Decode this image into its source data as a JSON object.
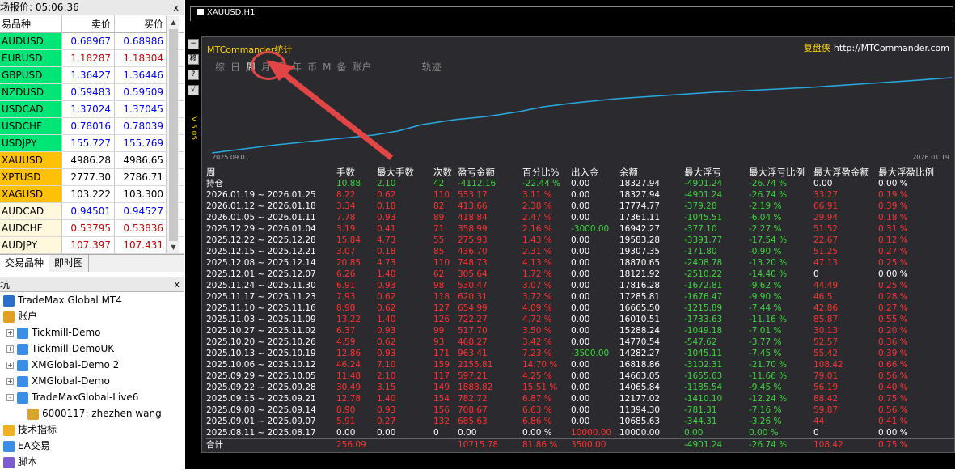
{
  "market_watch": {
    "title": "场报价: 05:06:36",
    "close": "x",
    "headers": [
      "易品种",
      "卖价",
      "买价"
    ],
    "rows": [
      {
        "sym": "AUDUSD",
        "bid": "0.68967",
        "ask": "0.68986",
        "bg": "#00e676",
        "bc": "#0000ff",
        "ac": "#0000ff"
      },
      {
        "sym": "EURUSD",
        "bid": "1.18287",
        "ask": "1.18304",
        "bg": "#00e676",
        "bc": "#cc0000",
        "ac": "#cc0000"
      },
      {
        "sym": "GBPUSD",
        "bid": "1.36427",
        "ask": "1.36446",
        "bg": "#00e676",
        "bc": "#0000ff",
        "ac": "#0000ff"
      },
      {
        "sym": "NZDUSD",
        "bid": "0.59483",
        "ask": "0.59509",
        "bg": "#00e676",
        "bc": "#0000ff",
        "ac": "#0000ff"
      },
      {
        "sym": "USDCAD",
        "bid": "1.37024",
        "ask": "1.37045",
        "bg": "#00e676",
        "bc": "#0000ff",
        "ac": "#0000ff"
      },
      {
        "sym": "USDCHF",
        "bid": "0.78016",
        "ask": "0.78039",
        "bg": "#00e676",
        "bc": "#0000ff",
        "ac": "#0000ff"
      },
      {
        "sym": "USDJPY",
        "bid": "155.727",
        "ask": "155.769",
        "bg": "#00e676",
        "bc": "#0000ff",
        "ac": "#0000ff"
      },
      {
        "sym": "XAUUSD",
        "bid": "4986.28",
        "ask": "4986.65",
        "bg": "#ffc107",
        "bc": "#000000",
        "ac": "#000000"
      },
      {
        "sym": "XPTUSD",
        "bid": "2777.30",
        "ask": "2786.71",
        "bg": "#ffc107",
        "bc": "#000000",
        "ac": "#000000"
      },
      {
        "sym": "XAGUSD",
        "bid": "103.222",
        "ask": "103.300",
        "bg": "#ffc107",
        "bc": "#000000",
        "ac": "#000000"
      },
      {
        "sym": "AUDCAD",
        "bid": "0.94501",
        "ask": "0.94527",
        "bg": "#fff8dc",
        "bc": "#0000ff",
        "ac": "#0000ff"
      },
      {
        "sym": "AUDCHF",
        "bid": "0.53795",
        "ask": "0.53836",
        "bg": "#fff8dc",
        "bc": "#cc0000",
        "ac": "#cc0000"
      },
      {
        "sym": "AUDJPY",
        "bid": "107.397",
        "ask": "107.431",
        "bg": "#fff8dc",
        "bc": "#cc0000",
        "ac": "#cc0000"
      }
    ],
    "tabs": [
      "交易品种",
      "即时图"
    ]
  },
  "navigator": {
    "title": "坑",
    "close": "x",
    "items": [
      {
        "label": "TradeMax Global MT4",
        "indent": 4,
        "pm": "",
        "icon": "terminal-icon"
      },
      {
        "label": "账户",
        "indent": 4,
        "pm": "",
        "icon": "accounts-icon"
      },
      {
        "label": "Tickmill-Demo",
        "indent": 8,
        "pm": "+",
        "icon": "server-icon"
      },
      {
        "label": "Tickmill-DemoUK",
        "indent": 8,
        "pm": "+",
        "icon": "server-icon"
      },
      {
        "label": "XMGlobal-Demo 2",
        "indent": 8,
        "pm": "+",
        "icon": "server-icon"
      },
      {
        "label": "XMGlobal-Demo",
        "indent": 8,
        "pm": "+",
        "icon": "server-icon"
      },
      {
        "label": "TradeMaxGlobal-Live6",
        "indent": 8,
        "pm": "-",
        "icon": "server-icon"
      },
      {
        "label": "6000117: zhezhen wang",
        "indent": 34,
        "pm": "",
        "icon": "user-icon"
      },
      {
        "label": "技术指标",
        "indent": 4,
        "pm": "",
        "icon": "indicator-icon"
      },
      {
        "label": "EA交易",
        "indent": 4,
        "pm": "",
        "icon": "ea-icon"
      },
      {
        "label": "脚本",
        "indent": 4,
        "pm": "",
        "icon": "script-icon"
      }
    ]
  },
  "chart": {
    "title": "XAUUSD,H1",
    "panel_title": "MTCommander统计",
    "brand_cn": "复盘侠",
    "brand_url": "http://MTCommander.com",
    "tabs": [
      "综",
      "日",
      "周",
      "月",
      "季",
      "年",
      "币",
      "M",
      "备",
      "账户",
      "轨迹"
    ],
    "active_tab": "周",
    "side_buttons": [
      "−",
      "移",
      "?",
      "√"
    ],
    "v_label": "V 5.05",
    "curve_start": "2025.09.01",
    "curve_end": "2026.01.19",
    "headers": [
      "周",
      "手数",
      "最大手数",
      "次数",
      "盈亏金额",
      "百分比%",
      "出入金",
      "余额",
      "最大浮亏",
      "最大浮亏比例",
      "最大浮盈金额",
      "最大浮盈比例"
    ],
    "hold_row": [
      "持仓",
      "10.88",
      "2.10",
      "42",
      "-4112.16",
      "-22.44 %",
      "0.00",
      "18327.94",
      "-4901.24",
      "-26.74 %",
      "0.00",
      "0.00 %"
    ],
    "rows": [
      [
        "2026.01.19 ~ 2026.01.25",
        "8.22",
        "0.62",
        "110",
        "553.17",
        "3.11 %",
        "0.00",
        "18327.94",
        "-4901.24",
        "-26.74 %",
        "33.27",
        "0.19 %"
      ],
      [
        "2026.01.12 ~ 2026.01.18",
        "3.34",
        "0.18",
        "82",
        "413.66",
        "2.38 %",
        "0.00",
        "17774.77",
        "-379.28",
        "-2.19 %",
        "66.91",
        "0.39 %"
      ],
      [
        "2026.01.05 ~ 2026.01.11",
        "7.78",
        "0.93",
        "89",
        "418.84",
        "2.47 %",
        "0.00",
        "17361.11",
        "-1045.51",
        "-6.04 %",
        "29.94",
        "0.18 %"
      ],
      [
        "2025.12.29 ~ 2026.01.04",
        "3.19",
        "0.41",
        "71",
        "358.99",
        "2.16 %",
        "-3000.00",
        "16942.27",
        "-377.10",
        "-2.27 %",
        "51.52",
        "0.31 %"
      ],
      [
        "2025.12.22 ~ 2025.12.28",
        "15.84",
        "4.73",
        "55",
        "275.93",
        "1.43 %",
        "0.00",
        "19583.28",
        "-3391.77",
        "-17.54 %",
        "22.67",
        "0.12 %"
      ],
      [
        "2025.12.15 ~ 2025.12.21",
        "3.07",
        "0.18",
        "85",
        "436.70",
        "2.31 %",
        "0.00",
        "19307.35",
        "-171.80",
        "-0.90 %",
        "51.25",
        "0.27 %"
      ],
      [
        "2025.12.08 ~ 2025.12.14",
        "20.85",
        "4.73",
        "110",
        "748.73",
        "4.13 %",
        "0.00",
        "18870.65",
        "-2408.78",
        "-13.20 %",
        "47.13",
        "0.25 %"
      ],
      [
        "2025.12.01 ~ 2025.12.07",
        "6.26",
        "1.40",
        "62",
        "305.64",
        "1.72 %",
        "0.00",
        "18121.92",
        "-2510.22",
        "-14.40 %",
        "0",
        "0.00 %"
      ],
      [
        "2025.11.24 ~ 2025.11.30",
        "6.91",
        "0.93",
        "98",
        "530.47",
        "3.07 %",
        "0.00",
        "17816.28",
        "-1672.81",
        "-9.62 %",
        "44.49",
        "0.25 %"
      ],
      [
        "2025.11.17 ~ 2025.11.23",
        "7.93",
        "0.62",
        "118",
        "620.31",
        "3.72 %",
        "0.00",
        "17285.81",
        "-1676.47",
        "-9.90 %",
        "46.5",
        "0.28 %"
      ],
      [
        "2025.11.10 ~ 2025.11.16",
        "8.98",
        "0.62",
        "127",
        "654.99",
        "4.09 %",
        "0.00",
        "16665.50",
        "-1215.89",
        "-7.44 %",
        "42.86",
        "0.27 %"
      ],
      [
        "2025.11.03 ~ 2025.11.09",
        "13.22",
        "1.40",
        "126",
        "722.27",
        "4.72 %",
        "0.00",
        "16010.51",
        "-1733.63",
        "-11.16 %",
        "85.87",
        "0.55 %"
      ],
      [
        "2025.10.27 ~ 2025.11.02",
        "6.37",
        "0.93",
        "99",
        "517.70",
        "3.50 %",
        "0.00",
        "15288.24",
        "-1049.18",
        "-7.01 %",
        "30.13",
        "0.20 %"
      ],
      [
        "2025.10.20 ~ 2025.10.26",
        "4.59",
        "0.62",
        "93",
        "468.27",
        "3.42 %",
        "0.00",
        "14770.54",
        "-547.62",
        "-3.77 %",
        "52.57",
        "0.36 %"
      ],
      [
        "2025.10.13 ~ 2025.10.19",
        "12.86",
        "0.93",
        "171",
        "963.41",
        "7.23 %",
        "-3500.00",
        "14282.27",
        "-1045.11",
        "-7.45 %",
        "55.42",
        "0.39 %"
      ],
      [
        "2025.10.06 ~ 2025.10.12",
        "46.24",
        "7.10",
        "159",
        "2155.81",
        "14.70 %",
        "0.00",
        "16818.86",
        "-3102.31",
        "-21.70 %",
        "108.42",
        "0.66 %"
      ],
      [
        "2025.09.29 ~ 2025.10.05",
        "11.48",
        "2.10",
        "117",
        "597.21",
        "4.25 %",
        "0.00",
        "14663.05",
        "-1655.63",
        "-11.66 %",
        "79.01",
        "0.56 %"
      ],
      [
        "2025.09.22 ~ 2025.09.28",
        "30.49",
        "3.15",
        "149",
        "1888.82",
        "15.51 %",
        "0.00",
        "14065.84",
        "-1185.54",
        "-9.45 %",
        "56.19",
        "0.40 %"
      ],
      [
        "2025.09.15 ~ 2025.09.21",
        "12.78",
        "1.40",
        "154",
        "782.72",
        "6.87 %",
        "0.00",
        "12177.02",
        "-1410.10",
        "-12.24 %",
        "88.42",
        "0.75 %"
      ],
      [
        "2025.09.08 ~ 2025.09.14",
        "8.90",
        "0.93",
        "156",
        "708.67",
        "6.63 %",
        "0.00",
        "11394.30",
        "-781.31",
        "-7.16 %",
        "59.87",
        "0.56 %"
      ],
      [
        "2025.09.01 ~ 2025.09.07",
        "5.91",
        "0.27",
        "132",
        "685.63",
        "6.86 %",
        "0.00",
        "10685.63",
        "-344.31",
        "-3.26 %",
        "44",
        "0.41 %"
      ],
      [
        "2025.08.11 ~ 2025.08.17",
        "0.00",
        "0.00",
        "0",
        "0.00",
        "0.00 %",
        "10000.00",
        "10000.00",
        "0.00",
        "0.00 %",
        "0",
        "0.00 %"
      ]
    ],
    "total_row": [
      "合计",
      "256.09",
      "",
      "",
      "10715.78",
      "81.86 %",
      "3500.00",
      "",
      "-4901.24",
      "-26.74 %",
      "108.42",
      "0.75 %"
    ],
    "colors": {
      "curve": "#29a8e0",
      "accent": "#ffd700",
      "pos": "#ff3030",
      "neg": "#3cd63c",
      "annot": "#e24545"
    }
  }
}
